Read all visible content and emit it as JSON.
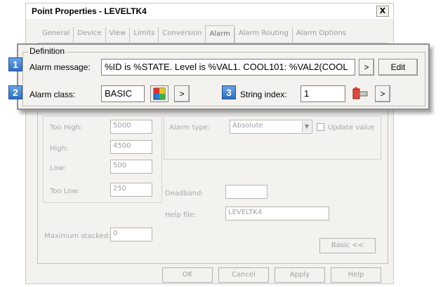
{
  "window": {
    "title": "Point Properties - LEVELTK4",
    "close_glyph": "X"
  },
  "tabs": [
    {
      "label": "General"
    },
    {
      "label": "Device"
    },
    {
      "label": "View"
    },
    {
      "label": "Limits"
    },
    {
      "label": "Conversion"
    },
    {
      "label": "Alarm",
      "active": true
    },
    {
      "label": "Alarm Routing"
    },
    {
      "label": "Alarm Options"
    }
  ],
  "definition": {
    "group_label": "Definition",
    "alarm_message": {
      "badge": "1",
      "label": "Alarm message:",
      "value": "%ID is %STATE. Level is %VAL1. COOL101: %VAL2(COOL",
      "browse_label": ">",
      "edit_label": "Edit"
    },
    "alarm_class": {
      "badge": "2",
      "label": "Alarm class:",
      "value": "BASIC",
      "icon": "palette-icon",
      "browse_label": ">"
    },
    "string_index": {
      "badge": "3",
      "label": "String index:",
      "value": "1",
      "icon": "edit-string-icon",
      "browse_label": ">"
    }
  },
  "limits": {
    "too_high": {
      "label": "Too High:",
      "value": "5000"
    },
    "high": {
      "label": "High:",
      "value": "4500"
    },
    "low": {
      "label": "Low:",
      "value": "500"
    },
    "too_low": {
      "label": "Too Low:",
      "value": "250"
    }
  },
  "alarm_type": {
    "label": "Alarm type:",
    "value": "Absolute"
  },
  "update_value": {
    "label": "Update value",
    "checked": false
  },
  "deadband": {
    "label": "Deadband:",
    "value": ""
  },
  "help_file": {
    "label": "Help file:",
    "value": "LEVELTK4"
  },
  "max_stacked": {
    "label": "Maximum stacked:",
    "value": "0"
  },
  "basic_button": {
    "label": "Basic <<"
  },
  "footer": {
    "ok": "OK",
    "cancel": "Cancel",
    "apply": "Apply",
    "help": "Help"
  }
}
